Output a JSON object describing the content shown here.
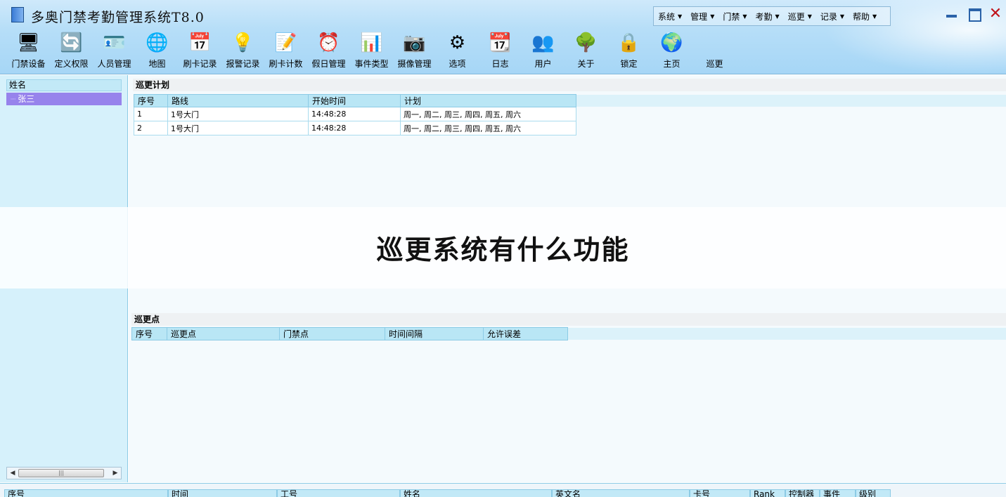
{
  "app": {
    "title": "多奥门禁考勤管理系统T8.0"
  },
  "menubar": [
    "系统",
    "管理",
    "门禁",
    "考勤",
    "巡更",
    "记录",
    "帮助"
  ],
  "toolbar": [
    {
      "label": "门禁设备",
      "icon": "monitor-icon",
      "glyph": "🖥"
    },
    {
      "label": "定义权限",
      "icon": "refresh-icon",
      "glyph": "🔄"
    },
    {
      "label": "人员管理",
      "icon": "id-card-icon",
      "glyph": "🪪"
    },
    {
      "label": "地图",
      "icon": "globe-icon",
      "glyph": "🌐"
    },
    {
      "label": "刷卡记录",
      "icon": "calendar-grid-icon",
      "glyph": "📅"
    },
    {
      "label": "报警记录",
      "icon": "lightbulb-icon",
      "glyph": "💡"
    },
    {
      "label": "刷卡计数",
      "icon": "notepad-icon",
      "glyph": "📝"
    },
    {
      "label": "假日管理",
      "icon": "alarm-clock-icon",
      "glyph": "⏰"
    },
    {
      "label": "事件类型",
      "icon": "document-chart-icon",
      "glyph": "📊"
    },
    {
      "label": "摄像管理",
      "icon": "camera-lens-icon",
      "glyph": "📷"
    },
    {
      "label": "选项",
      "icon": "gear-icon",
      "glyph": "⚙"
    },
    {
      "label": "日志",
      "icon": "calendar-30-icon",
      "glyph": "📆"
    },
    {
      "label": "用户",
      "icon": "users-icon",
      "glyph": "👥"
    },
    {
      "label": "关于",
      "icon": "tree-icon",
      "glyph": "🌳"
    },
    {
      "label": "锁定",
      "icon": "padlock-icon",
      "glyph": "🔒"
    },
    {
      "label": "主页",
      "icon": "home-globe-icon",
      "glyph": "🌍"
    },
    {
      "label": "巡更",
      "icon": "",
      "glyph": ""
    }
  ],
  "left_panel": {
    "header": "姓名",
    "rows": [
      "张三"
    ]
  },
  "patrol_plan": {
    "title": "巡更计划",
    "columns": [
      "序号",
      "路线",
      "开始时间",
      "计划"
    ],
    "rows": [
      [
        "1",
        "1号大门",
        "14:48:28",
        "周一, 周二, 周三, 周四, 周五, 周六"
      ],
      [
        "2",
        "1号大门",
        "14:48:28",
        "周一, 周二, 周三, 周四, 周五, 周六"
      ]
    ]
  },
  "patrol_points": {
    "title": "巡更点",
    "columns": [
      "序号",
      "巡更点",
      "门禁点",
      "时间间隔",
      "允许误差"
    ]
  },
  "overlay": {
    "text": "巡更系统有什么功能"
  },
  "log_table": {
    "columns": [
      "序号",
      "时间",
      "工号",
      "姓名",
      "英文名",
      "卡号",
      "Rank",
      "控制器",
      "事件",
      "级别"
    ]
  },
  "colors": {
    "selected_row": "#9783ec",
    "header_bg": "#b9e6f5",
    "close_button": "#c0141b"
  }
}
